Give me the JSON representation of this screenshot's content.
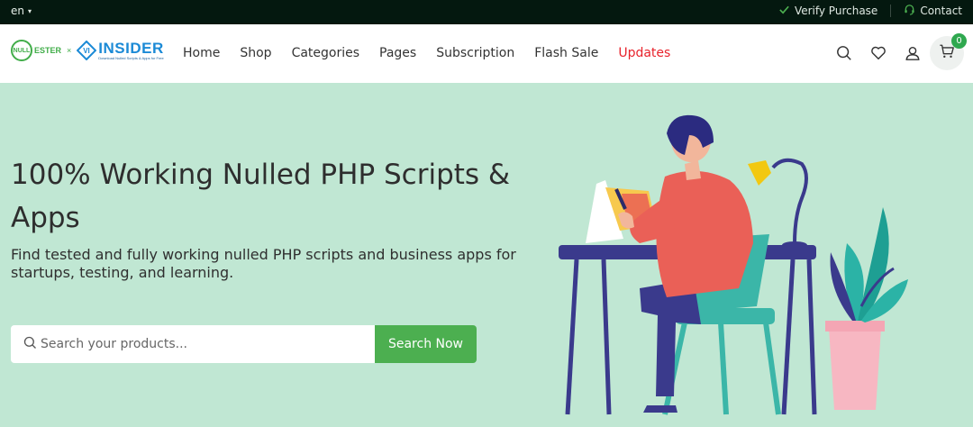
{
  "topbar": {
    "language": "en",
    "verify_purchase": "Verify Purchase",
    "contact": "Contact"
  },
  "brand": {
    "left_logo_text": "NULL",
    "left_logo_suffix": "ESTER",
    "separator": "×",
    "right_logo_badge": "VI",
    "right_logo_text": "INSIDER",
    "right_logo_tagline": "Download Nulled Scripts & Apps for Free",
    "brand_green": "#41ad49",
    "brand_blue": "#1b8ad6"
  },
  "nav": {
    "items": [
      {
        "label": "Home"
      },
      {
        "label": "Shop"
      },
      {
        "label": "Categories"
      },
      {
        "label": "Pages"
      },
      {
        "label": "Subscription"
      },
      {
        "label": "Flash Sale"
      },
      {
        "label": "Updates",
        "highlight": "#e8232c"
      }
    ]
  },
  "header_icons": {
    "search": "search-icon",
    "wishlist": "heart-icon",
    "account": "user-icon",
    "cart": "cart-icon",
    "cart_count": "0"
  },
  "hero": {
    "title": "100% Working Nulled PHP Scripts & Apps",
    "subtitle": "Find tested and fully working nulled PHP scripts and business apps for startups, testing, and learning.",
    "search_placeholder": "Search your products...",
    "search_button": "Search Now",
    "background": "#c0e7d3",
    "button_color": "#4caf50"
  }
}
